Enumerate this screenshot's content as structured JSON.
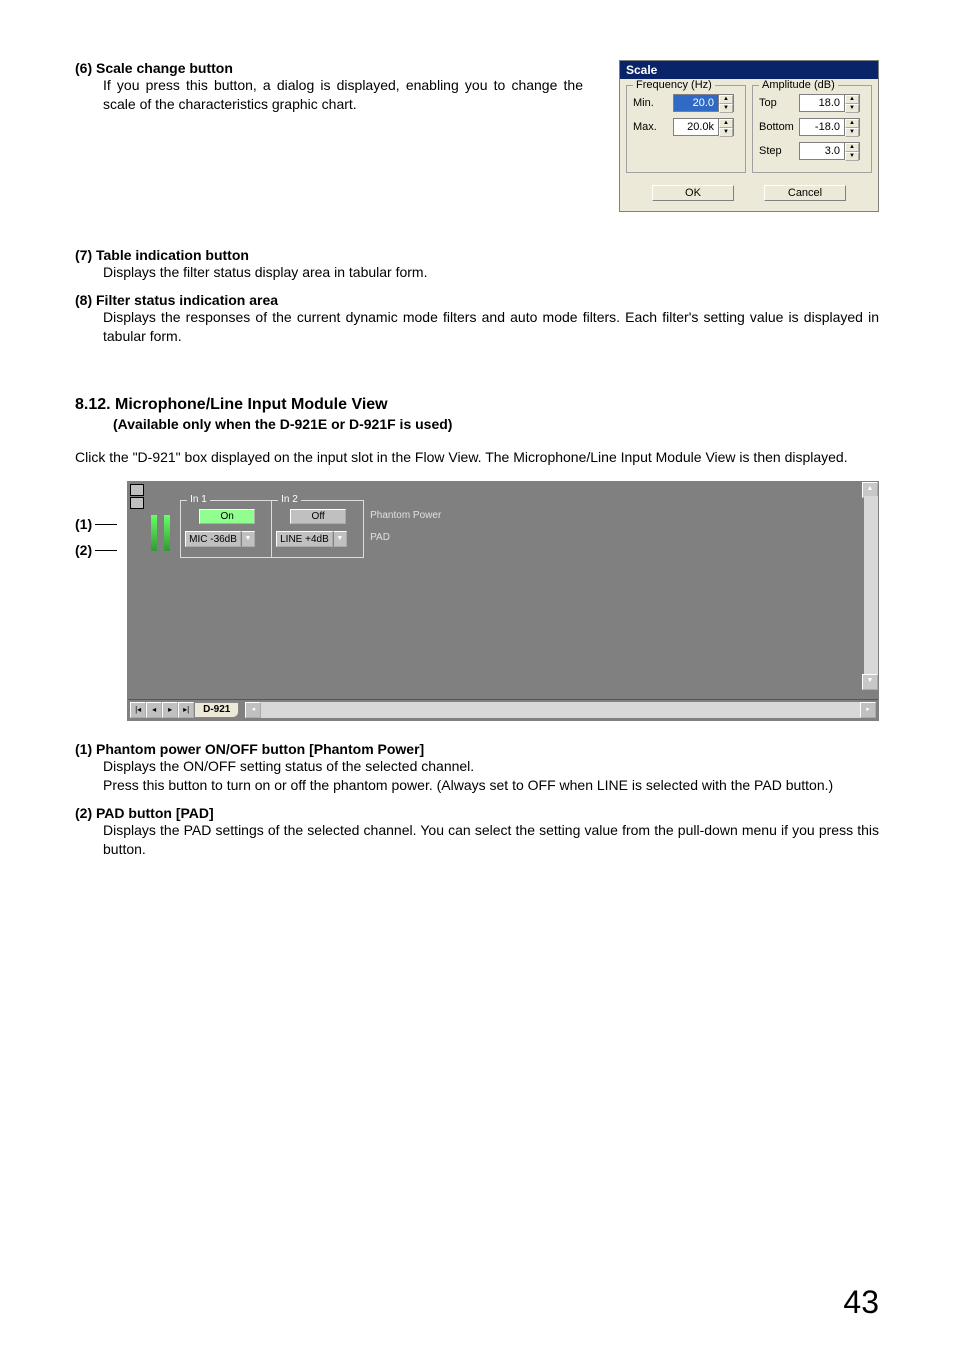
{
  "items": {
    "i6": {
      "title": "(6) Scale change button",
      "body": "If you press this button, a dialog is displayed, enabling you to change the scale of the characteristics graphic chart."
    },
    "i7": {
      "title": "(7) Table indication button",
      "body": "Displays the filter status display area in tabular form."
    },
    "i8": {
      "title": "(8) Filter status indication area",
      "body": "Displays the responses of the current dynamic mode filters and auto mode filters. Each filter's setting value is displayed in tabular form."
    },
    "i1b": {
      "title": "(1) Phantom power ON/OFF button [Phantom Power]",
      "body1": "Displays the ON/OFF setting status of the selected channel.",
      "body2": "Press this button to turn on or off the phantom power. (Always set to OFF when LINE is selected with the PAD button.)"
    },
    "i2b": {
      "title": "(2) PAD button [PAD]",
      "body": "Displays the PAD settings of the selected channel. You can select the setting value from the pull-down menu if you press this button."
    }
  },
  "scale_dialog": {
    "title": "Scale",
    "freq_legend": "Frequency (Hz)",
    "amp_legend": "Amplitude (dB)",
    "min_label": "Min.",
    "max_label": "Max.",
    "top_label": "Top",
    "bottom_label": "Bottom",
    "step_label": "Step",
    "min_val": "20.0",
    "max_val": "20.0k",
    "top_val": "18.0",
    "bottom_val": "-18.0",
    "step_val": "3.0",
    "ok": "OK",
    "cancel": "Cancel"
  },
  "section": {
    "heading": "8.12. Microphone/Line Input Module View",
    "subheading": "(Available only when the D-921E or D-921F is used)",
    "intro": "Click the \"D-921\" box displayed on the input slot in the Flow View. The Microphone/Line Input Module View is then displayed."
  },
  "module_view": {
    "in1": "In 1",
    "in2": "In 2",
    "on": "On",
    "off": "Off",
    "mic": "MIC  -36dB",
    "line": "LINE  +4dB",
    "phantom": "Phantom Power",
    "pad": "PAD",
    "tab": "D-921"
  },
  "callouts": {
    "c1": "(1)",
    "c2": "(2)"
  },
  "page_number": "43"
}
